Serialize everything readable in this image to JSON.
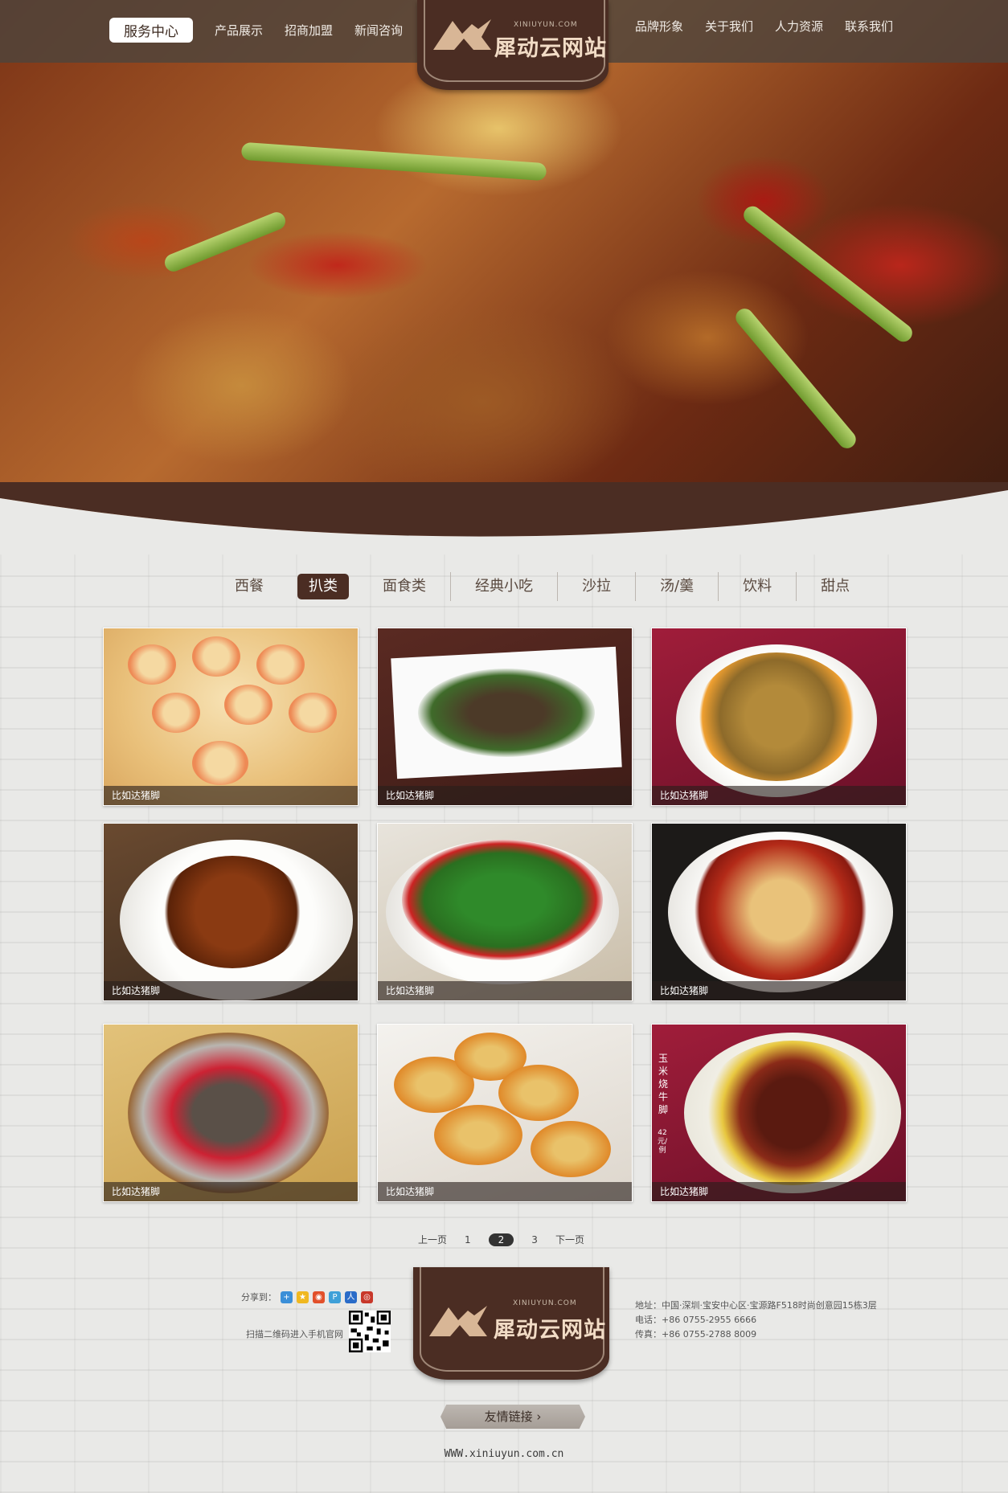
{
  "header": {
    "nav_left": [
      "服务中心",
      "产品展示",
      "招商加盟",
      "新闻咨询"
    ],
    "nav_right": [
      "品牌形象",
      "关于我们",
      "人力资源",
      "联系我们"
    ],
    "active_nav": "服务中心",
    "logo_small": "XINIUYUN.COM",
    "logo_text": "犀动云网站"
  },
  "categories": [
    "西餐",
    "扒类",
    "面食类",
    "经典小吃",
    "沙拉",
    "汤/羹",
    "饮料",
    "甜点"
  ],
  "active_category": "扒类",
  "products": [
    {
      "caption": "比如达猪脚"
    },
    {
      "caption": "比如达猪脚"
    },
    {
      "caption": "比如达猪脚"
    },
    {
      "caption": "比如达猪脚"
    },
    {
      "caption": "比如达猪脚"
    },
    {
      "caption": "比如达猪脚"
    },
    {
      "caption": "比如达猪脚"
    },
    {
      "caption": "比如达猪脚"
    },
    {
      "caption": "比如达猪脚"
    }
  ],
  "product_card_text": {
    "vertical_label": "玉米烧牛脚",
    "price_label": "42元/例"
  },
  "pagination": {
    "prev": "上一页",
    "pages": [
      "1",
      "2",
      "3"
    ],
    "current": "2",
    "next": "下一页"
  },
  "footer": {
    "share_label": "分享到：",
    "qr_label": "扫描二维码进入手机官网",
    "logo_small": "XINIUYUN.COM",
    "logo_text": "犀动云网站",
    "address": "地址：中国·深圳·宝安中心区·宝源路F518时尚创意园15栋3层",
    "phone": "电话：+86 0755-2955 6666",
    "fax": "传真：+86 0755-2788 8009",
    "friend_link": "友情链接 ›",
    "website": "WWW.xiniuyun.com.cn"
  },
  "colors": {
    "brand_brown": "#4b2d23",
    "header_overlay": "#4e443c",
    "background": "#e9e9e7"
  }
}
